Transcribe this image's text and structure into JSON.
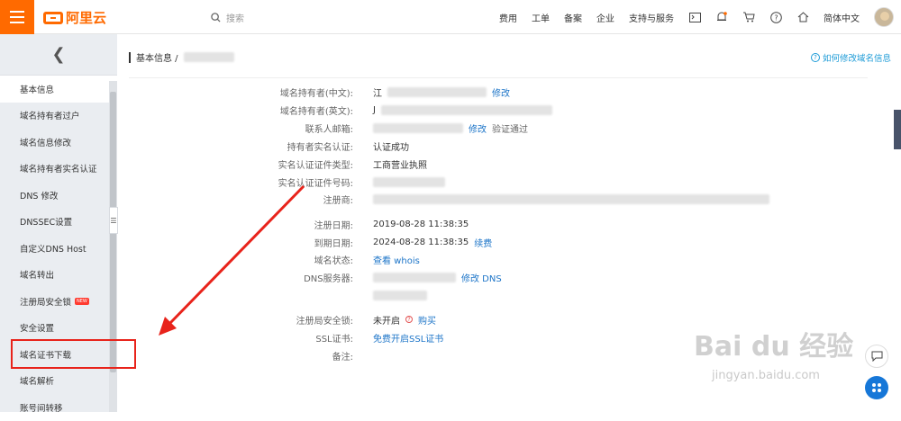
{
  "topbar": {
    "brand": "阿里云",
    "search_placeholder": "搜索",
    "nav": [
      "费用",
      "工单",
      "备案",
      "企业",
      "支持与服务"
    ],
    "language": "简体中文",
    "icons": [
      "terminal-icon",
      "bell-icon",
      "cart-icon",
      "help-icon",
      "home-icon"
    ]
  },
  "sidebar": {
    "back_glyph": "❮",
    "items": [
      {
        "label": "基本信息",
        "active": true
      },
      {
        "label": "域名持有者过户"
      },
      {
        "label": "域名信息修改"
      },
      {
        "label": "域名持有者实名认证"
      },
      {
        "label": "DNS 修改"
      },
      {
        "label": "DNSSEC设置"
      },
      {
        "label": "自定义DNS Host"
      },
      {
        "label": "域名转出"
      },
      {
        "label": "注册局安全锁",
        "badge": "NEW"
      },
      {
        "label": "安全设置"
      },
      {
        "label": "域名证书下载",
        "highlighted": true
      },
      {
        "label": "域名解析"
      },
      {
        "label": "账号间转移"
      }
    ]
  },
  "main": {
    "breadcrumb": "基本信息 /",
    "help_link": "如何修改域名信息",
    "rows": {
      "owner_cn": {
        "label": "域名持有者(中文):",
        "value": "江",
        "action": "修改"
      },
      "owner_en": {
        "label": "域名持有者(英文):",
        "value": "J"
      },
      "email": {
        "label": "联系人邮箱:",
        "action": "修改",
        "status": "验证通过"
      },
      "realname": {
        "label": "持有者实名认证:",
        "value": "认证成功"
      },
      "cert_type": {
        "label": "实名认证证件类型:",
        "value": "工商营业执照"
      },
      "cert_no": {
        "label": "实名认证证件号码:"
      },
      "registrar": {
        "label": "注册商:"
      },
      "reg_date": {
        "label": "注册日期:",
        "value": "2019-08-28 11:38:35"
      },
      "exp_date": {
        "label": "到期日期:",
        "value": "2024-08-28 11:38:35",
        "action": "续费"
      },
      "status": {
        "label": "域名状态:",
        "action": "查看 whois"
      },
      "dns": {
        "label": "DNS服务器:",
        "action": "修改 DNS"
      },
      "lock": {
        "label": "注册局安全锁:",
        "value": "未开启",
        "action": "购买"
      },
      "ssl": {
        "label": "SSL证书:",
        "action": "免费开启SSL证书"
      },
      "remark": {
        "label": "备注:"
      }
    }
  },
  "watermark": {
    "main": "Bai du 经验",
    "sub": "jingyan.baidu.com"
  },
  "colors": {
    "brand": "#ff6a00",
    "link": "#1d75c8",
    "highlight": "#e8231b",
    "float_blue": "#1677d8"
  }
}
